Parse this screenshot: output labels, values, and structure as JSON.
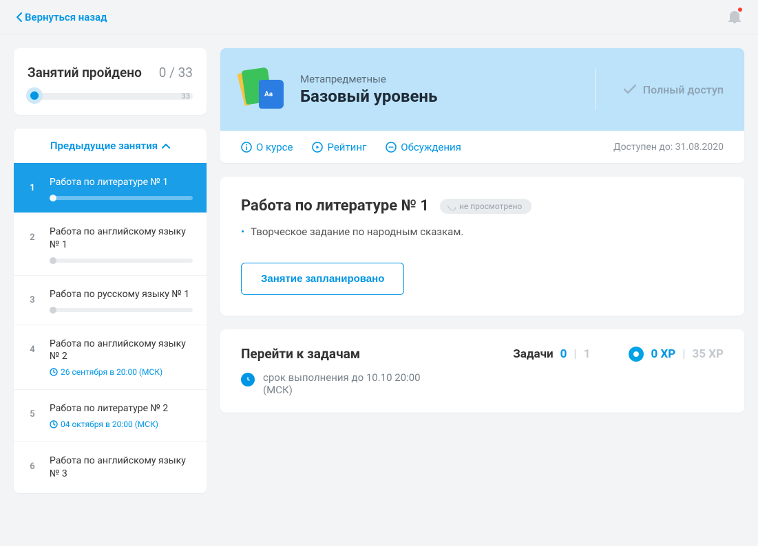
{
  "back_label": "Вернуться назад",
  "progress": {
    "label": "Занятий пройдено",
    "counter": "0 / 33",
    "end_label": "33"
  },
  "lessons_header": "Предыдущие занятия",
  "lessons": [
    {
      "num": "1",
      "title": "Работа по литературе № 1",
      "schedule": "",
      "active": true,
      "showBar": true
    },
    {
      "num": "2",
      "title": "Работа по английскому языку № 1",
      "schedule": "",
      "active": false,
      "showBar": true
    },
    {
      "num": "3",
      "title": "Работа по русскому языку № 1",
      "schedule": "",
      "active": false,
      "showBar": true
    },
    {
      "num": "4",
      "title": "Работа по английскому языку № 2",
      "schedule": "26 сентября в 20:00 (МСК)",
      "active": false,
      "showBar": false
    },
    {
      "num": "5",
      "title": "Работа по литературе № 2",
      "schedule": "04 октября в 20:00 (МСК)",
      "active": false,
      "showBar": false
    },
    {
      "num": "6",
      "title": "Работа по английскому языку № 3",
      "schedule": "",
      "active": false,
      "showBar": false
    }
  ],
  "course": {
    "category": "Метапредметные",
    "title": "Базовый уровень",
    "access_label": "Полный доступ",
    "about": "О курсе",
    "rating": "Рейтинг",
    "discussions": "Обсуждения",
    "available_until": "Доступен до: 31.08.2020",
    "icon_aa": "Aa"
  },
  "lesson_detail": {
    "title": "Работа по литературе № 1",
    "badge": "не просмотрено",
    "description": "Творческое задание по народным сказкам.",
    "button": "Занятие запланировано"
  },
  "tasks": {
    "title": "Перейти к задачам",
    "label": "Задачи",
    "done": "0",
    "sep": "|",
    "total": "1",
    "xp_done": "0 XP",
    "xp_sep": "|",
    "xp_total": "35 XP",
    "deadline": "срок выполнения до 10.10 20:00 (МСК)"
  }
}
